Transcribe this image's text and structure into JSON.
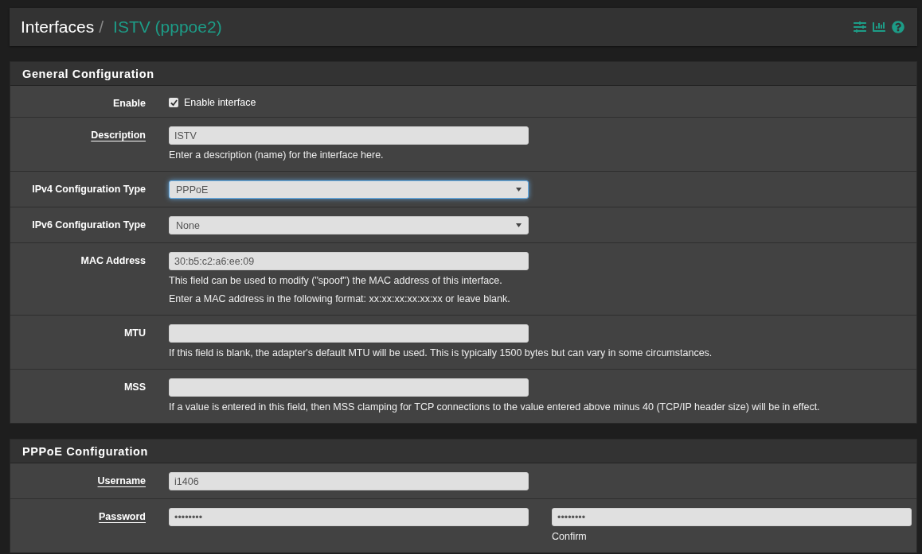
{
  "breadcrumb": {
    "parent": "Interfaces",
    "separator": "/",
    "current": "ISTV (pppoe2)"
  },
  "sections": [
    {
      "title": "General Configuration",
      "rows": [
        {
          "label": "Enable",
          "link": false,
          "kind": "checkbox",
          "checked": true,
          "text": "Enable interface"
        },
        {
          "label": "Description",
          "link": true,
          "kind": "text",
          "value": "ISTV",
          "help": [
            "Enter a description (name) for the interface here."
          ]
        },
        {
          "label": "IPv4 Configuration Type",
          "link": false,
          "kind": "select",
          "value": "PPPoE",
          "focused": true
        },
        {
          "label": "IPv6 Configuration Type",
          "link": false,
          "kind": "select",
          "value": "None",
          "focused": false
        },
        {
          "label": "MAC Address",
          "link": false,
          "kind": "text",
          "value": "30:b5:c2:a6:ee:09",
          "help": [
            "This field can be used to modify (\"spoof\") the MAC address of this interface.",
            "Enter a MAC address in the following format: xx:xx:xx:xx:xx:xx or leave blank."
          ]
        },
        {
          "label": "MTU",
          "link": false,
          "kind": "text",
          "help": [
            "If this field is blank, the adapter's default MTU will be used. This is typically 1500 bytes but can vary in some circumstances."
          ]
        },
        {
          "label": "MSS",
          "link": false,
          "kind": "text",
          "help": [
            "If a value is entered in this field, then MSS clamping for TCP connections to the value entered above minus 40 (TCP/IP header size) will be in effect."
          ]
        }
      ]
    },
    {
      "title": "PPPoE Configuration",
      "rows": [
        {
          "label": "Username",
          "link": true,
          "kind": "text",
          "value": "i1406"
        },
        {
          "label": "Password",
          "link": true,
          "kind": "password",
          "value": "••••••••",
          "confirm": {
            "value": "••••••••",
            "caption": "Confirm"
          }
        }
      ]
    }
  ]
}
